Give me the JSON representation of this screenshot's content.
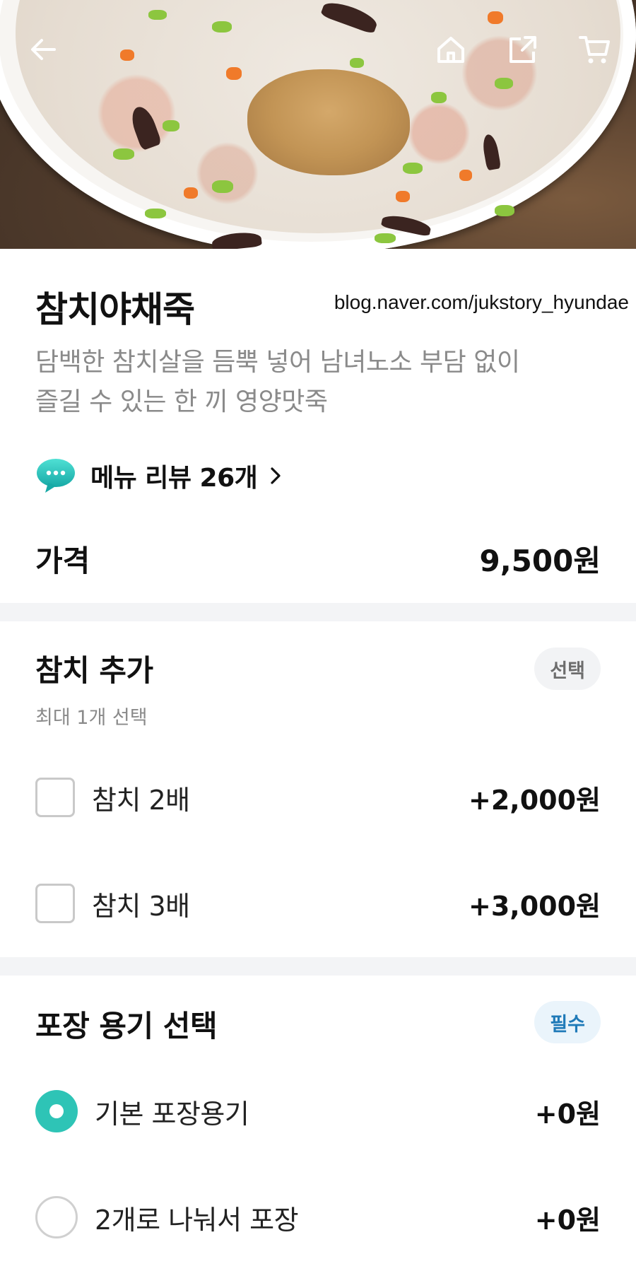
{
  "header": {
    "back_icon": "back-arrow-icon",
    "home_icon": "home-icon",
    "share_icon": "share-icon",
    "cart_icon": "cart-icon"
  },
  "menu": {
    "title": "참치야채죽",
    "watermark": "blog.naver.com/jukstory_hyundae",
    "description_line1": "담백한 참치살을 듬뿍 넣어 남녀노소 부담 없이",
    "description_line2": "즐길 수 있는 한 끼 영양맛죽",
    "review_label": "메뉴 리뷰 26개",
    "price_label": "가격",
    "price_value": "9,500원"
  },
  "option_groups": [
    {
      "title": "참치 추가",
      "subtitle": "최대 1개 선택",
      "badge": "선택",
      "type": "checkbox",
      "options": [
        {
          "label": "참치 2배",
          "price": "+2,000원",
          "selected": false
        },
        {
          "label": "참치 3배",
          "price": "+3,000원",
          "selected": false
        }
      ]
    },
    {
      "title": "포장 용기 선택",
      "badge": "필수",
      "type": "radio",
      "options": [
        {
          "label": "기본 포장용기",
          "price": "+0원",
          "selected": true
        },
        {
          "label": "2개로 나눠서 포장",
          "price": "+0원",
          "selected": false
        }
      ]
    }
  ],
  "colors": {
    "accent": "#2ec4b6",
    "required_badge_text": "#1f7ab8",
    "muted_text": "#8a8a8a"
  }
}
